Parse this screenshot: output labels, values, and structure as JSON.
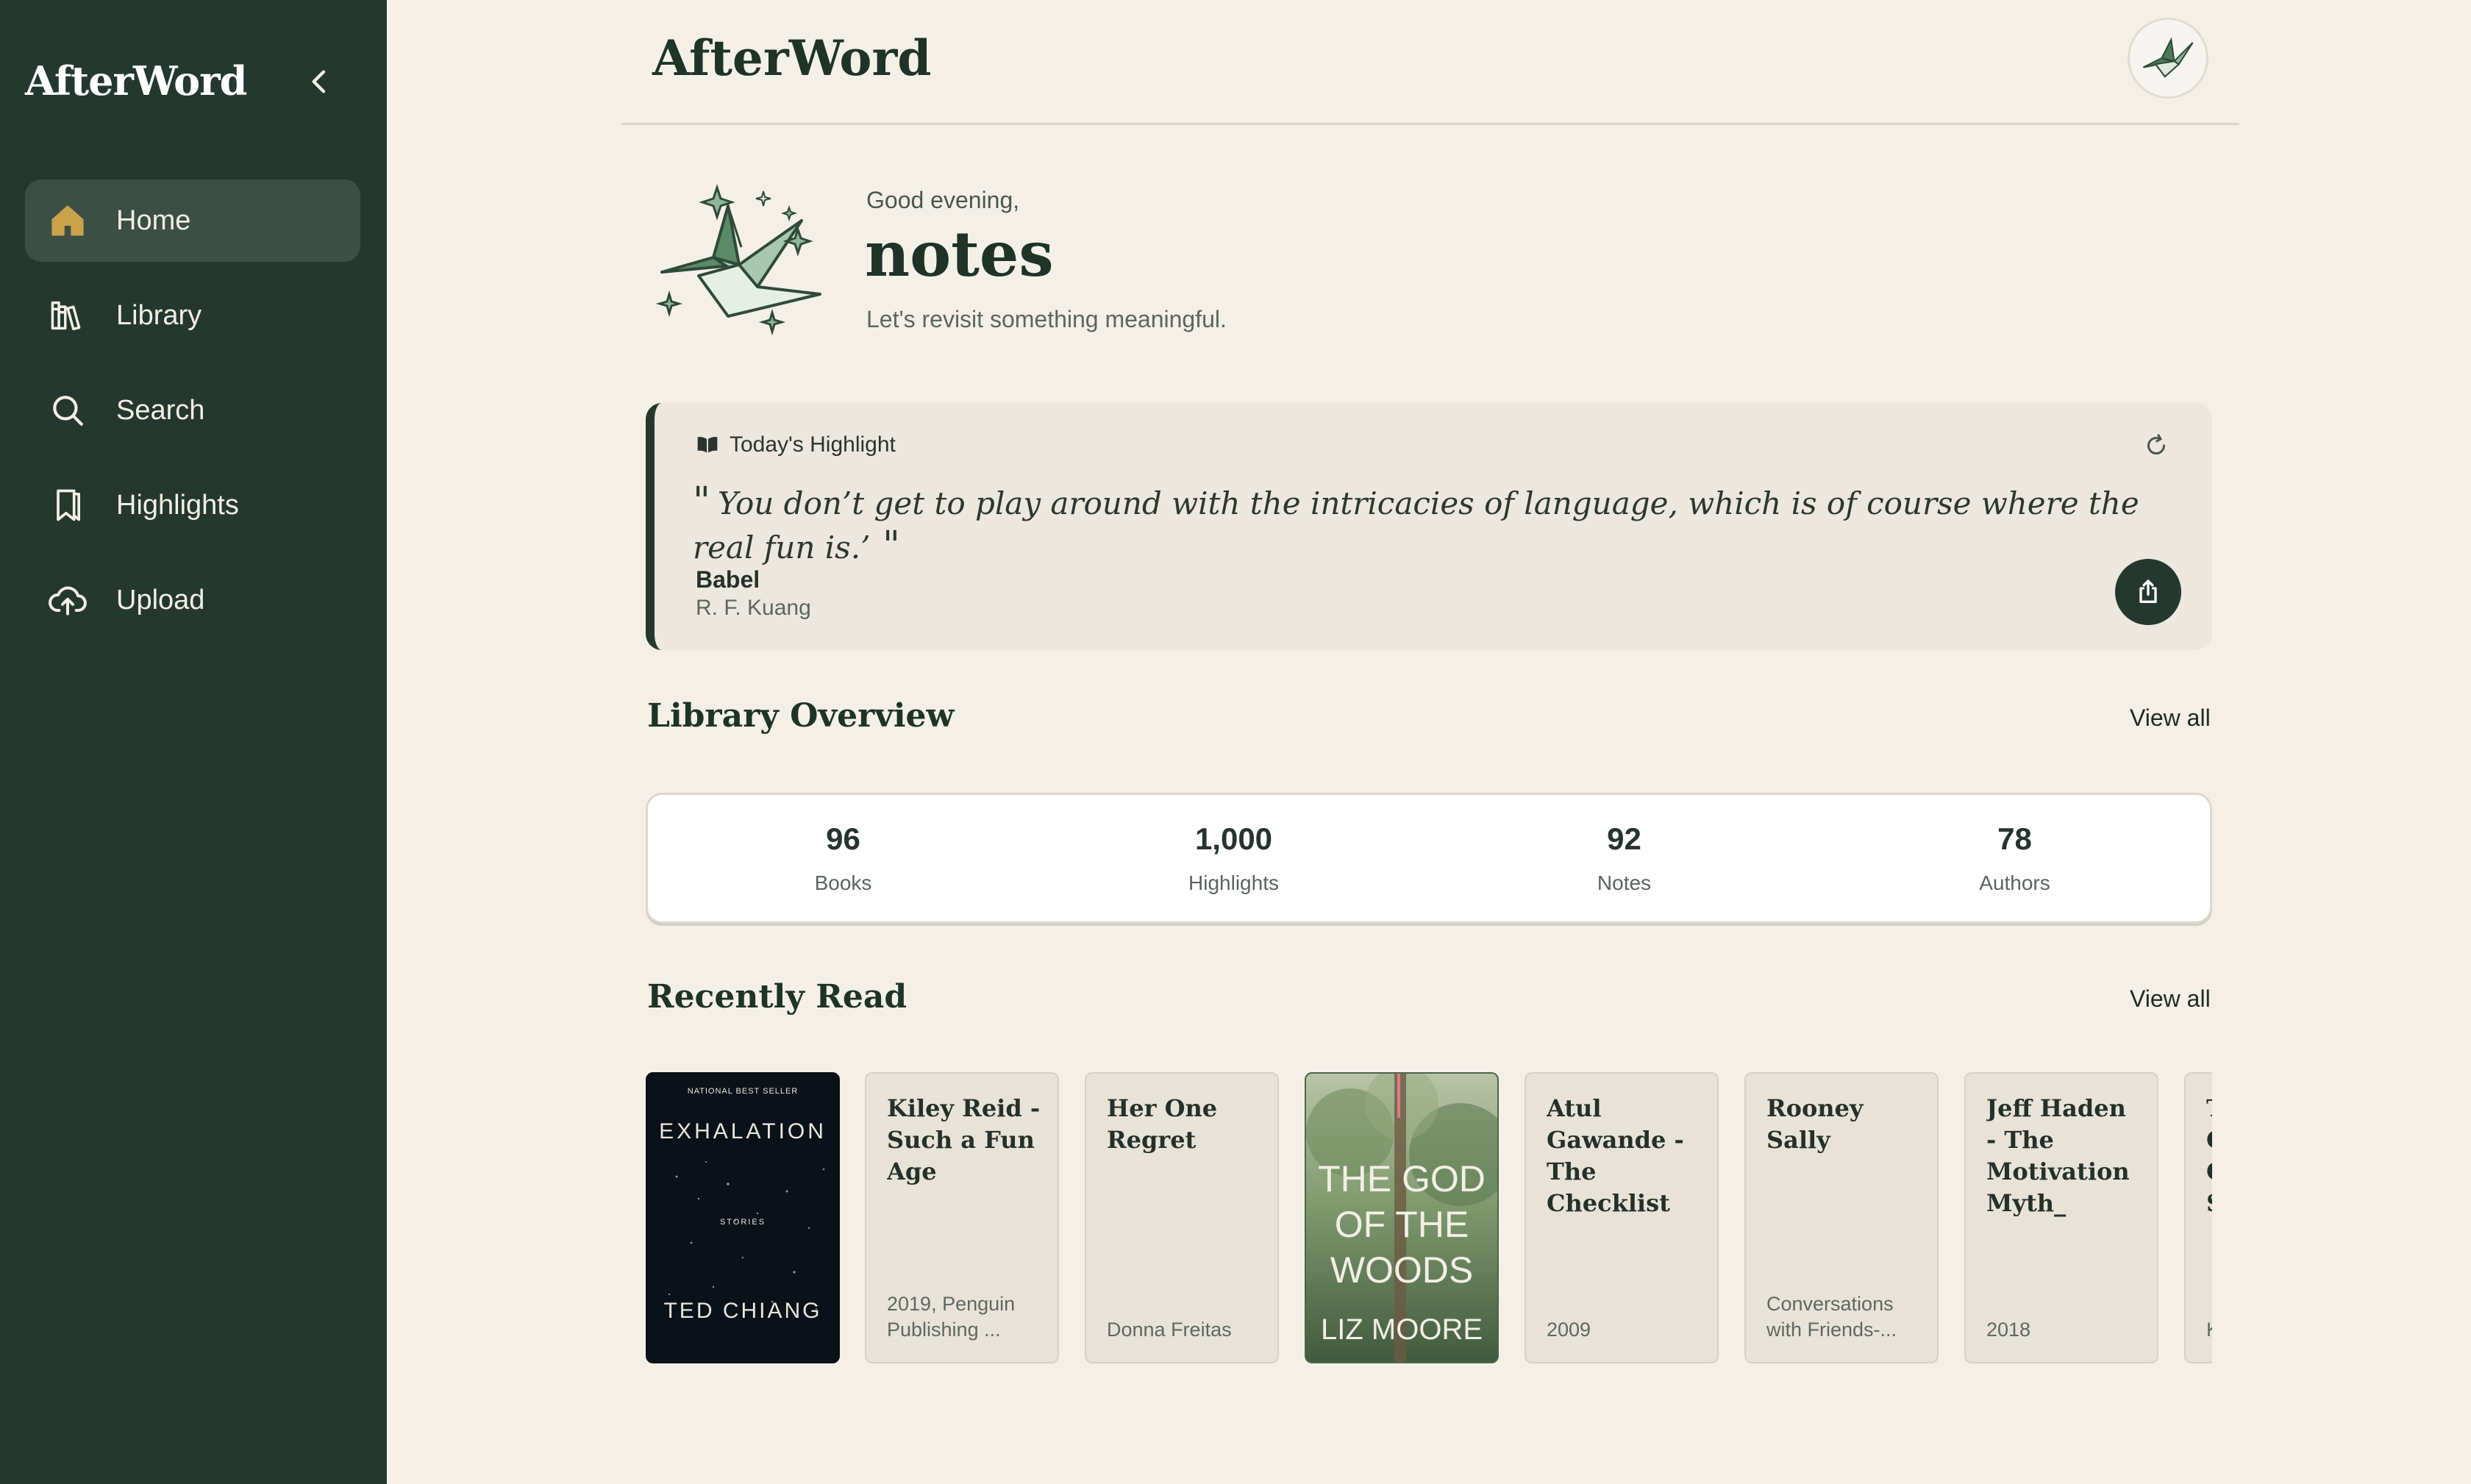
{
  "sidebar": {
    "brand": "AfterWord",
    "items": [
      {
        "label": "Home",
        "icon": "home-icon",
        "active": true
      },
      {
        "label": "Library",
        "icon": "library-icon"
      },
      {
        "label": "Search",
        "icon": "search-icon"
      },
      {
        "label": "Highlights",
        "icon": "bookmark-icon"
      },
      {
        "label": "Upload",
        "icon": "cloud-upload-icon"
      }
    ]
  },
  "header": {
    "title": "AfterWord"
  },
  "greeting": {
    "salutation": "Good evening,",
    "name": "notes",
    "subtitle": "Let's revisit something meaningful."
  },
  "highlight": {
    "label": "Today's Highlight",
    "open_quote": "\"",
    "quote": "You don’t get to play around with the intricacies of language, which is of course where the real fun is.’",
    "close_quote": " \"",
    "book": "Babel",
    "author": "R. F. Kuang"
  },
  "library_overview": {
    "title": "Library Overview",
    "view_all": "View all",
    "stats": [
      {
        "value": "96",
        "label": "Books"
      },
      {
        "value": "1,000",
        "label": "Highlights"
      },
      {
        "value": "92",
        "label": "Notes"
      },
      {
        "value": "78",
        "label": "Authors"
      }
    ]
  },
  "recently_read": {
    "title": "Recently Read",
    "view_all": "View all",
    "books": [
      {
        "cover": "exhalation",
        "cover_top": "NATIONAL BEST SELLER",
        "cover_title": "EXHALATION",
        "cover_mid": "STORIES",
        "cover_author": "TED  CHIANG"
      },
      {
        "title": "Kiley Reid - Such a Fun Age",
        "meta": "2019, Penguin Publishing ..."
      },
      {
        "title": "Her One Regret",
        "meta": "Donna Freitas"
      },
      {
        "cover": "god-of-the-woods",
        "cover_title_1": "THE GOD",
        "cover_title_2": "OF THE",
        "cover_title_3": "WOODS",
        "cover_author": "LIZ MOORE"
      },
      {
        "title": "Atul Gawande - The Checklist Manifesto_ ...",
        "meta": "2009"
      },
      {
        "title": "Rooney Sally",
        "meta": "Conversations with Friends-..."
      },
      {
        "title": "Jeff Haden - The Motivation Myth_ How...",
        "meta": "2018"
      },
      {
        "title": "T C C S",
        "meta": "K"
      }
    ]
  },
  "colors": {
    "sidebar": "#24382f",
    "background": "#f4f0e8",
    "accent": "#c9a24a"
  }
}
